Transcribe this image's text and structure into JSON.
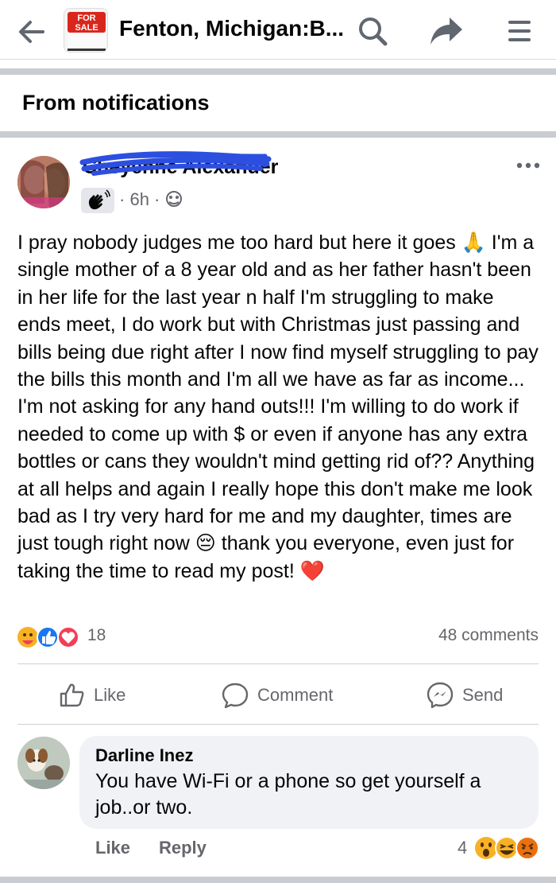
{
  "header": {
    "title": "Fenton, Michigan:B...",
    "group_badge_text": "FOR SALE",
    "from_notifications": "From notifications"
  },
  "post": {
    "author": "Cheyenne Alexander",
    "time": "6h",
    "text": "I pray nobody judges me too hard but here it goes 🙏 I'm a single mother of a 8 year old and as her father hasn't been in her life for the last year n half I'm struggling to make ends meet, I do work but with Christmas just passing and bills being due right after I now find myself struggling to pay the bills this month and I'm all we have as far as income... I'm not asking for any hand outs!!! I'm willing to do work if needed to come up with $ or even if anyone has any extra bottles or cans they wouldn't mind getting rid of?? Anything at all helps and again I really hope this don't make me look bad as I try very hard for me and my daughter, times are just tough right now 😔 thank you everyone, even just for taking the time to read my post! ❤️",
    "reaction_count": "18",
    "comments_count": "48 comments",
    "actions": {
      "like": "Like",
      "comment": "Comment",
      "send": "Send"
    }
  },
  "comment": {
    "author": "Darline Inez",
    "text": "You have Wi-Fi or a phone so get yourself a job..or two.",
    "like": "Like",
    "reply": "Reply",
    "reaction_count": "4"
  },
  "colors": {
    "text": "#050505",
    "secondary": "#65676b",
    "divider": "#ced0d4",
    "bubble": "#f0f2f5",
    "like_blue": "#1877f2",
    "love_red": "#f33e58"
  }
}
